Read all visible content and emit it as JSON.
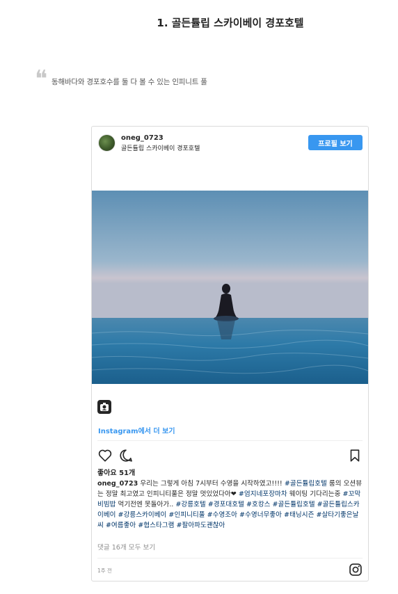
{
  "page": {
    "title": "1. 골든튤립 스카이베이 경포호텔",
    "quote": "동해바다와 경포호수를 둘 다 볼 수 있는 인피니트 풀",
    "quote_mark": "❝"
  },
  "post": {
    "username": "oneg_0723",
    "location": "골든튤립 스카이베이 경포호텔",
    "profile_button": "프로필 보기",
    "view_more": "Instagram에서 더 보기",
    "likes": "좋아요 51개",
    "caption_user": "oneg_0723",
    "caption_body": " 우리는 그렇게 아침 7시부터 수영을 시작하였고!!!! ",
    "caption_tags_1": "#골든튤립호텔",
    "caption_body_2": " 룸의 오션뷰는 정말 최고였고 인피니티풀은 정말 멋있었다아❤ ",
    "caption_tags_2": "#엄지네포장마차",
    "caption_body_3": " 웨이팅 기다리는중 ",
    "caption_tags_3": "#꼬막비빔밥",
    "caption_body_4": " 먹기전엔 못돌아가.. ",
    "caption_tags_4": "#강릉호텔 #경포대호텔 #호캉스 #골든튤립호텔 #골든튤립스카이베이 #강릉스카이베이 #인피니티풀 #수영조아 #수영너무좋아 #태닝시즌 #살타기좋은날씨 #여름좋아 #협스타그램 #팔아파도괜찮아",
    "comments": "댓글 16개 모두 보기",
    "timestamp": "1주 전"
  },
  "icons": {
    "heart": "heart-icon",
    "comment": "comment-icon",
    "bookmark": "bookmark-icon",
    "instagram": "instagram-icon",
    "instagram_small": "instagram-logo-icon"
  },
  "colors": {
    "accent": "#3897f0",
    "hashtag": "#003569",
    "muted": "#8e8e8e"
  }
}
